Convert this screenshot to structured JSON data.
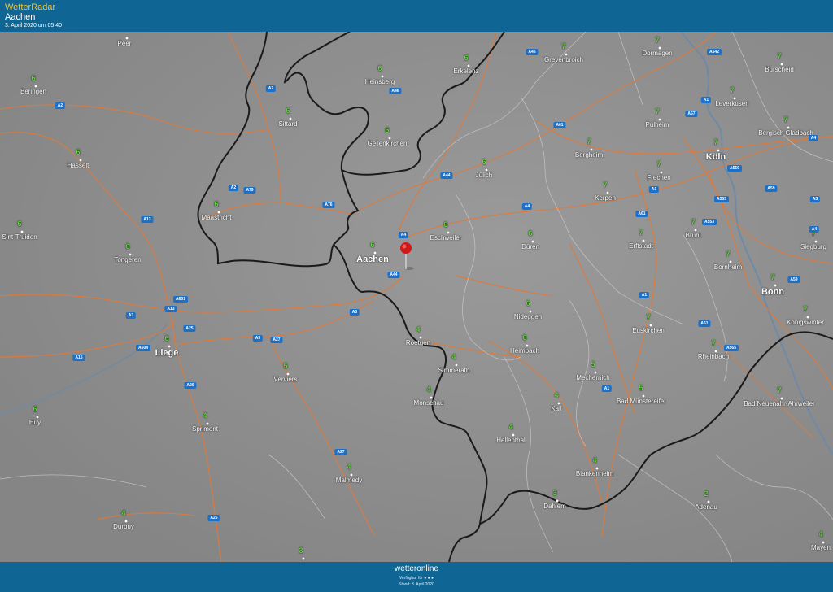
{
  "header": {
    "app_title": "WetterRadar",
    "location": "Aachen",
    "timestamp": "3. April 2020 um 05:40"
  },
  "footer": {
    "logo": "wetteronline",
    "available_for": "Verfügbar für ● ● ●",
    "stand": "Stand: 3. April 2020"
  },
  "colors": {
    "bar": "#0f6694",
    "map_bg": "#8c8c8c",
    "road": "#e07a3a",
    "border": "#1a1a1a",
    "value": "#5dd83a",
    "motorway_badge": "#1c70c8"
  },
  "cities": [
    {
      "name": "Peer",
      "value": ""
    },
    {
      "name": "Beringen",
      "value": "6"
    },
    {
      "name": "Heinsberg",
      "value": "6"
    },
    {
      "name": "Erkelenz",
      "value": "6"
    },
    {
      "name": "Grevenbroich",
      "value": "7"
    },
    {
      "name": "Dormagen",
      "value": "7"
    },
    {
      "name": "Burscheid",
      "value": "7"
    },
    {
      "name": "Sittard",
      "value": "6"
    },
    {
      "name": "Leverkusen",
      "value": "7"
    },
    {
      "name": "Pulheim",
      "value": "7"
    },
    {
      "name": "Bergisch Gladbach",
      "value": "7"
    },
    {
      "name": "Hasselt",
      "value": "6"
    },
    {
      "name": "Geilenkirchen",
      "value": "6"
    },
    {
      "name": "Bergheim",
      "value": "7"
    },
    {
      "name": "Köln",
      "value": "7"
    },
    {
      "name": "Jülich",
      "value": "6"
    },
    {
      "name": "Frechen",
      "value": "7"
    },
    {
      "name": "Kerpen",
      "value": "7"
    },
    {
      "name": "Maastricht",
      "value": "6"
    },
    {
      "name": "Sint-Truiden",
      "value": "6"
    },
    {
      "name": "Eschweiler",
      "value": "6"
    },
    {
      "name": "Düren",
      "value": "6"
    },
    {
      "name": "Erftstadt",
      "value": "7"
    },
    {
      "name": "Brühl",
      "value": "7"
    },
    {
      "name": "Siegburg",
      "value": "7"
    },
    {
      "name": "Tongeren",
      "value": "6"
    },
    {
      "name": "Aachen",
      "value": "6"
    },
    {
      "name": "Bornheim",
      "value": "7"
    },
    {
      "name": "Bonn",
      "value": "7"
    },
    {
      "name": "Nideggen",
      "value": "6"
    },
    {
      "name": "Königswinter",
      "value": "7"
    },
    {
      "name": "Roetgen",
      "value": "4"
    },
    {
      "name": "Euskirchen",
      "value": "7"
    },
    {
      "name": "Liege",
      "value": "6"
    },
    {
      "name": "Heimbach",
      "value": "6"
    },
    {
      "name": "Rheinbach",
      "value": "7"
    },
    {
      "name": "Simmerath",
      "value": "4"
    },
    {
      "name": "Mechernich",
      "value": "5"
    },
    {
      "name": "Verviers",
      "value": "5"
    },
    {
      "name": "Monschau",
      "value": "4"
    },
    {
      "name": "Kall",
      "value": "4"
    },
    {
      "name": "Bad Münstereifel",
      "value": "5"
    },
    {
      "name": "Bad Neuenahr-Ahrweiler",
      "value": "7"
    },
    {
      "name": "Huy",
      "value": "6"
    },
    {
      "name": "Sprimont",
      "value": "4"
    },
    {
      "name": "Hellenthal",
      "value": "4"
    },
    {
      "name": "Blankenheim",
      "value": "4"
    },
    {
      "name": "Malmedy",
      "value": "4"
    },
    {
      "name": "Dahlem",
      "value": "3"
    },
    {
      "name": "Adenau",
      "value": "2"
    },
    {
      "name": "Durbuy",
      "value": "4"
    },
    {
      "name": "Mayen",
      "value": "4"
    },
    {
      "name": "",
      "value": "3"
    }
  ],
  "roads": [
    "A46",
    "A542",
    "A2",
    "A46",
    "A1",
    "A57",
    "A61",
    "A2",
    "A79",
    "A44",
    "A4",
    "A559",
    "A59",
    "A4",
    "A555",
    "A3",
    "A76",
    "A13",
    "A1",
    "A553",
    "A4",
    "A44",
    "A61",
    "A3",
    "A601",
    "A13",
    "A3",
    "A25",
    "A3",
    "A27",
    "A604",
    "A15",
    "A59",
    "A1",
    "A61",
    "A565",
    "A26",
    "A1",
    "A27",
    "A26",
    "A13",
    "A2",
    "A4"
  ]
}
